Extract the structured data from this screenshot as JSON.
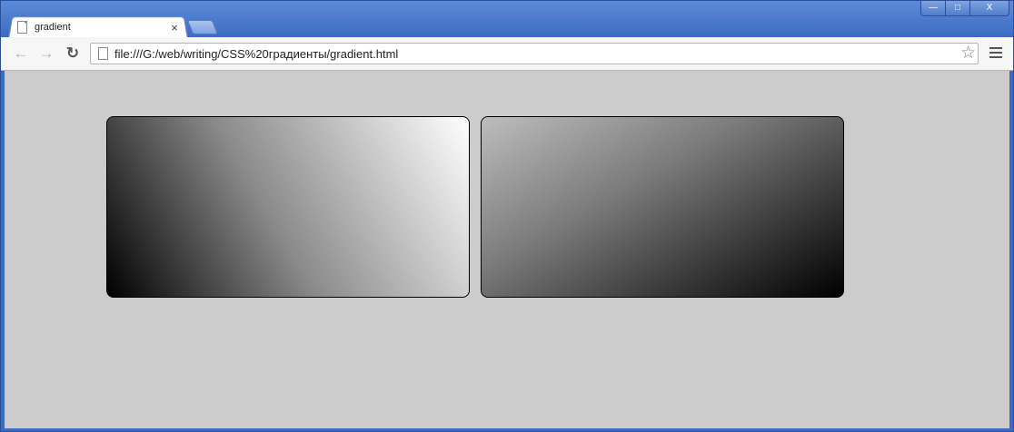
{
  "tab": {
    "title": "gradient",
    "close_glyph": "×"
  },
  "window_controls": {
    "minimize": "—",
    "maximize": "□",
    "close": "X"
  },
  "toolbar": {
    "back_icon": "arrow-left",
    "forward_icon": "arrow-right",
    "reload_icon": "reload",
    "url": "file:///G:/web/writing/CSS%20градиенты/gradient.html",
    "star_icon": "star"
  },
  "page": {
    "background": "#cccccc",
    "boxes": [
      {
        "name": "gradient-box-1",
        "from": "#000000",
        "to": "#ffffff"
      },
      {
        "name": "gradient-box-2",
        "from": "#bdbdbd",
        "to": "#000000"
      }
    ]
  }
}
